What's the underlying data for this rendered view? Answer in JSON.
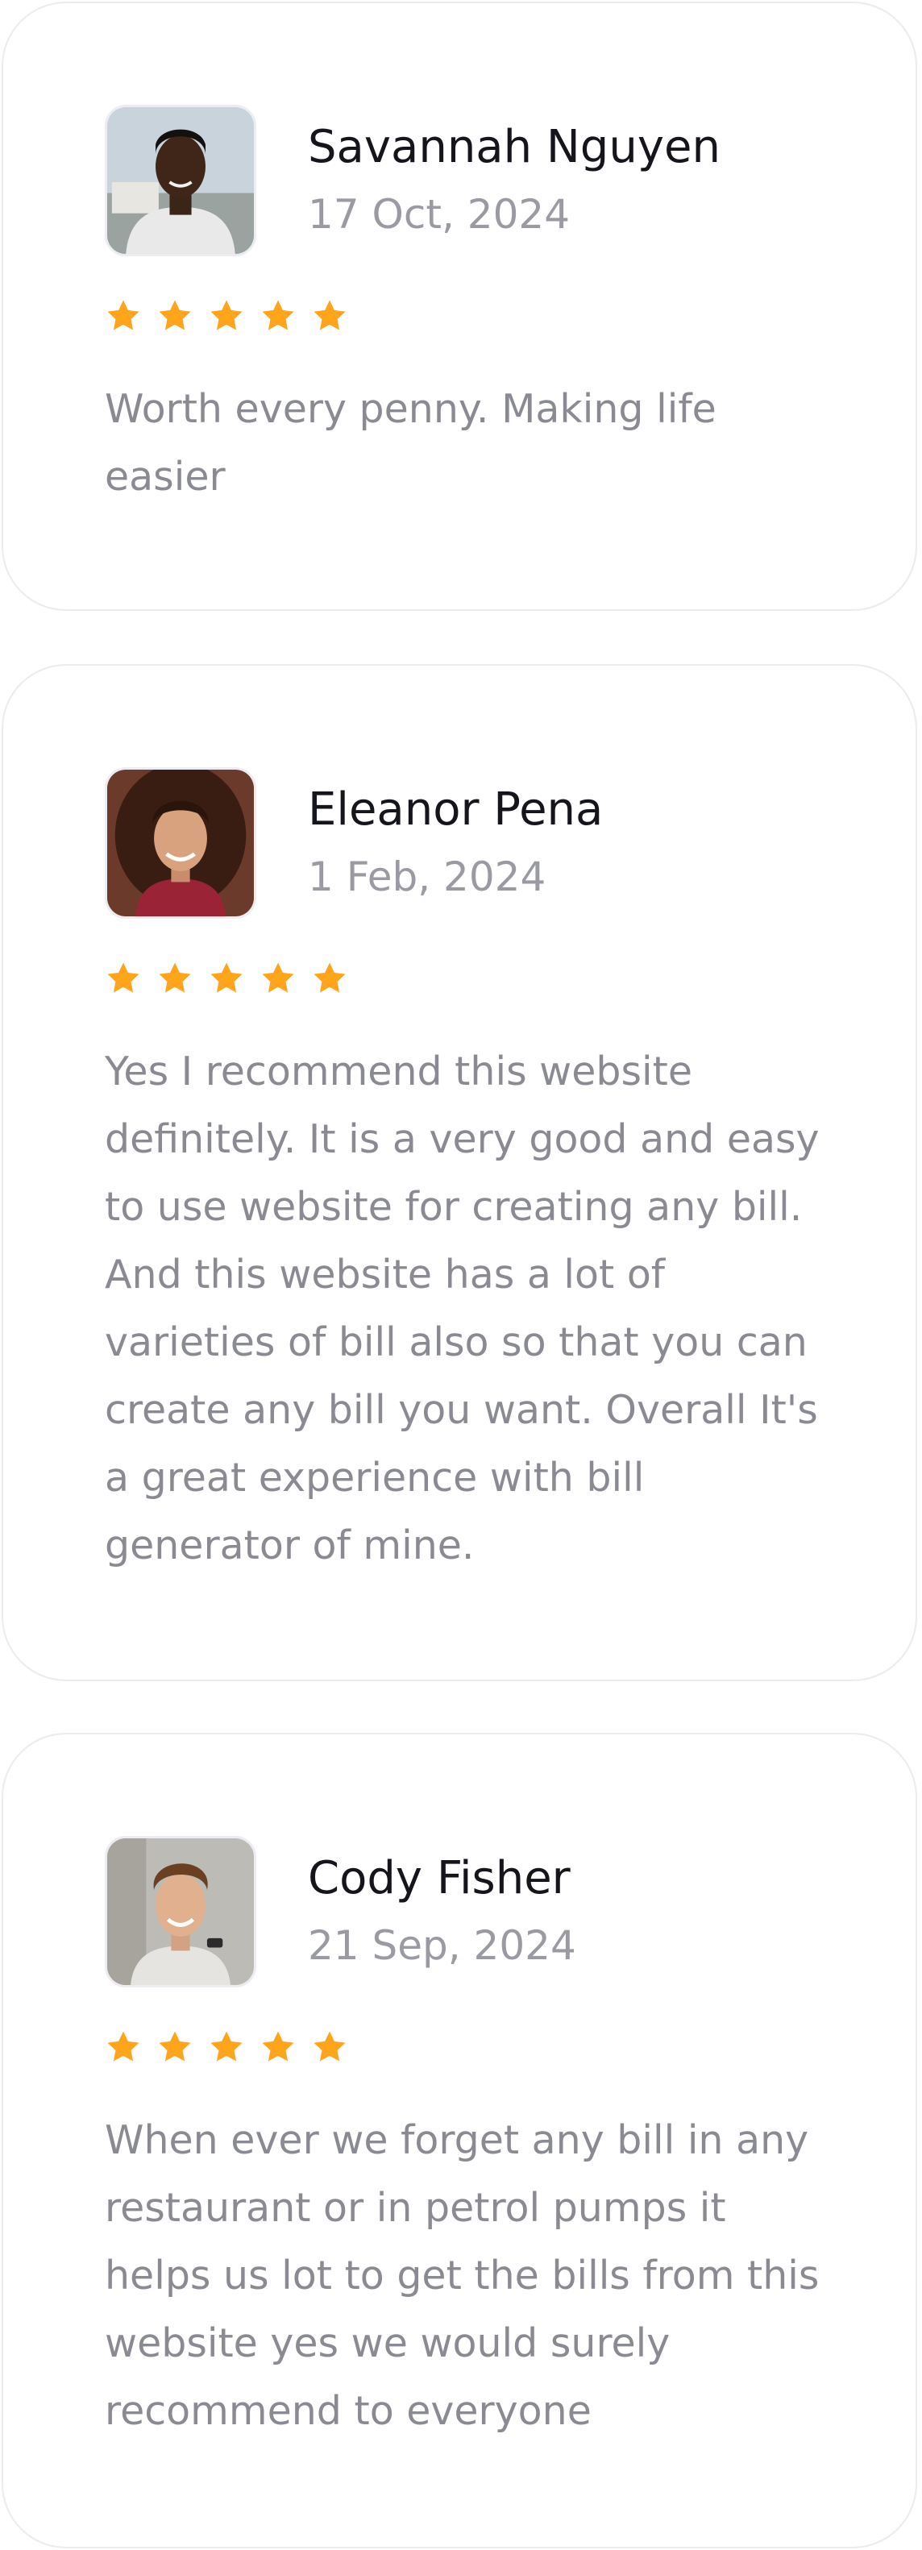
{
  "colors": {
    "star": "#ffa41b",
    "name": "#15151c",
    "muted": "#8a8a93",
    "card_border": "#ebebf0"
  },
  "reviews": [
    {
      "name": "Savannah Nguyen",
      "date": "17 Oct, 2024",
      "rating": 5,
      "text": "Worth every penny. Making life easier"
    },
    {
      "name": "Eleanor Pena",
      "date": "1 Feb, 2024",
      "rating": 5,
      "text": "Yes I recommend this website definitely. It is a very good and easy to use website for creating any bill. And this website has a lot of varieties of bill also so that you can create any bill you want. Overall It's a great experience with bill generator of mine."
    },
    {
      "name": "Cody Fisher",
      "date": "21 Sep, 2024",
      "rating": 5,
      "text": "When ever we forget any bill in any restaurant or in petrol pumps it helps us lot to get the bills from this website yes we would surely recommend to everyone"
    }
  ]
}
